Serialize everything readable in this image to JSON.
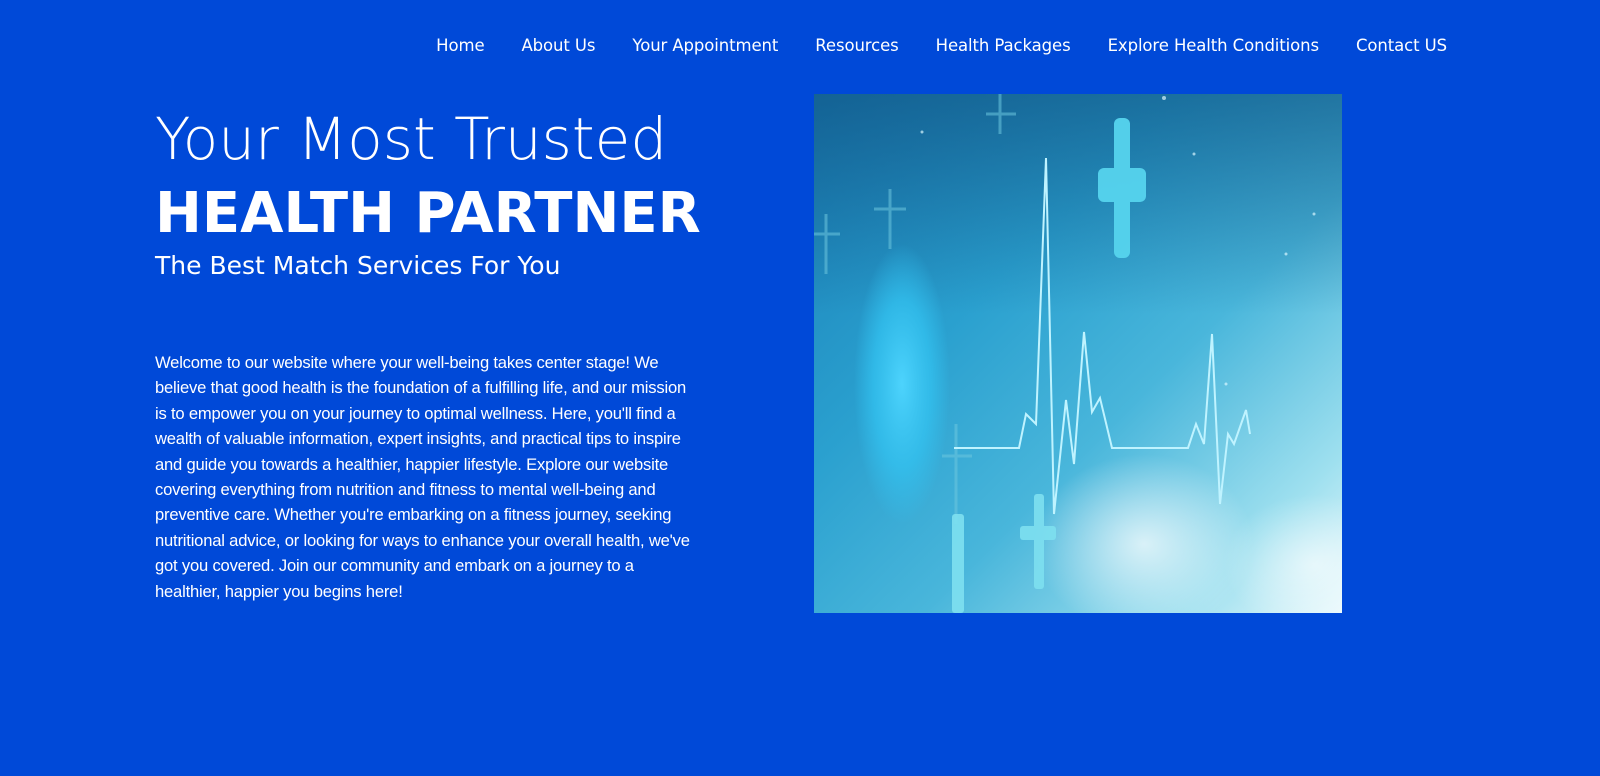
{
  "nav": {
    "items": [
      {
        "label": "Home"
      },
      {
        "label": "About Us"
      },
      {
        "label": "Your Appointment"
      },
      {
        "label": "Resources"
      },
      {
        "label": "Health Packages"
      },
      {
        "label": "Explore Health Conditions"
      },
      {
        "label": "Contact US"
      }
    ]
  },
  "hero": {
    "title_line1": "Your Most Trusted",
    "title_line2": "HEALTH PARTNER",
    "subtitle": "The Best Match Services For You",
    "body": "Welcome to our website where your well-being takes center stage! We believe that good health is the foundation of a fulfilling life, and our mission is to empower you on your journey to optimal wellness. Here, you'll find a wealth of valuable information, expert insights, and practical tips to inspire and guide you towards a healthier, happier lifestyle. Explore our website covering everything from nutrition and fitness to mental well-being and preventive care. Whether you're embarking on a fitness journey, seeking nutritional advice, or looking for ways to enhance your overall health, we've got you covered. Join our community and embark on a journey to a healthier, happier you begins here!",
    "image_icon": "medical-heartbeat-image"
  },
  "colors": {
    "background": "#0049d8",
    "text": "#ffffff"
  }
}
